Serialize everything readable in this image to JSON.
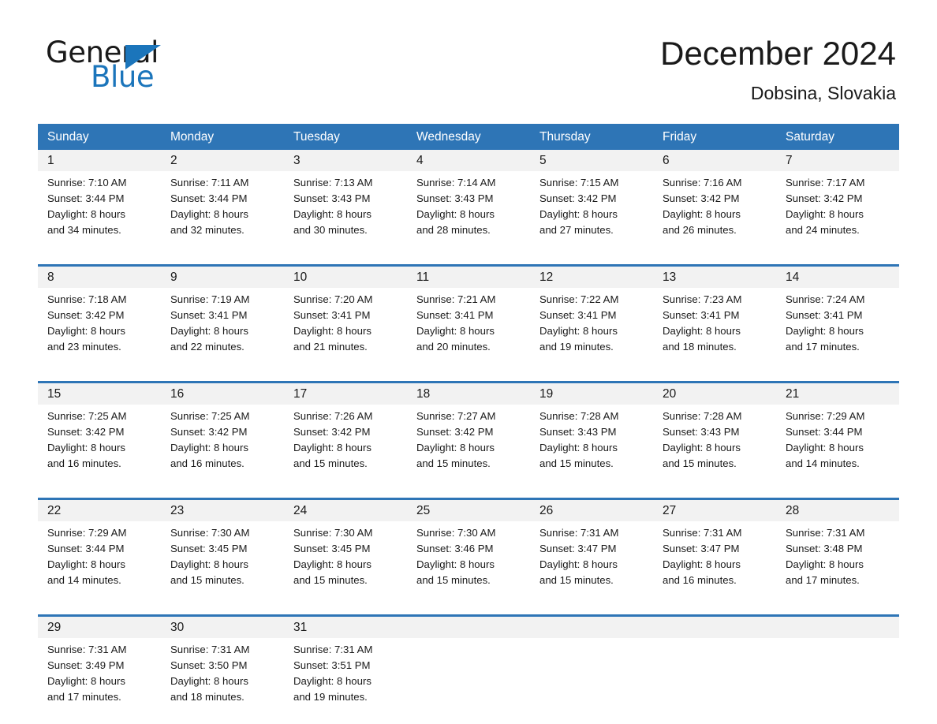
{
  "brand": {
    "word_one": "General",
    "word_two": "Blue",
    "triangle_color": "#1b75bb"
  },
  "header": {
    "title": "December 2024",
    "subtitle": "Dobsina, Slovakia"
  },
  "theme": {
    "header_blue": "#2e75b6",
    "daynum_band": "#f2f2f2",
    "text": "#1a1a1a"
  },
  "weekdays": [
    "Sunday",
    "Monday",
    "Tuesday",
    "Wednesday",
    "Thursday",
    "Friday",
    "Saturday"
  ],
  "weeks": [
    [
      {
        "day": "1",
        "sunrise": "Sunrise: 7:10 AM",
        "sunset": "Sunset: 3:44 PM",
        "daylight_1": "Daylight: 8 hours",
        "daylight_2": "and 34 minutes."
      },
      {
        "day": "2",
        "sunrise": "Sunrise: 7:11 AM",
        "sunset": "Sunset: 3:44 PM",
        "daylight_1": "Daylight: 8 hours",
        "daylight_2": "and 32 minutes."
      },
      {
        "day": "3",
        "sunrise": "Sunrise: 7:13 AM",
        "sunset": "Sunset: 3:43 PM",
        "daylight_1": "Daylight: 8 hours",
        "daylight_2": "and 30 minutes."
      },
      {
        "day": "4",
        "sunrise": "Sunrise: 7:14 AM",
        "sunset": "Sunset: 3:43 PM",
        "daylight_1": "Daylight: 8 hours",
        "daylight_2": "and 28 minutes."
      },
      {
        "day": "5",
        "sunrise": "Sunrise: 7:15 AM",
        "sunset": "Sunset: 3:42 PM",
        "daylight_1": "Daylight: 8 hours",
        "daylight_2": "and 27 minutes."
      },
      {
        "day": "6",
        "sunrise": "Sunrise: 7:16 AM",
        "sunset": "Sunset: 3:42 PM",
        "daylight_1": "Daylight: 8 hours",
        "daylight_2": "and 26 minutes."
      },
      {
        "day": "7",
        "sunrise": "Sunrise: 7:17 AM",
        "sunset": "Sunset: 3:42 PM",
        "daylight_1": "Daylight: 8 hours",
        "daylight_2": "and 24 minutes."
      }
    ],
    [
      {
        "day": "8",
        "sunrise": "Sunrise: 7:18 AM",
        "sunset": "Sunset: 3:42 PM",
        "daylight_1": "Daylight: 8 hours",
        "daylight_2": "and 23 minutes."
      },
      {
        "day": "9",
        "sunrise": "Sunrise: 7:19 AM",
        "sunset": "Sunset: 3:41 PM",
        "daylight_1": "Daylight: 8 hours",
        "daylight_2": "and 22 minutes."
      },
      {
        "day": "10",
        "sunrise": "Sunrise: 7:20 AM",
        "sunset": "Sunset: 3:41 PM",
        "daylight_1": "Daylight: 8 hours",
        "daylight_2": "and 21 minutes."
      },
      {
        "day": "11",
        "sunrise": "Sunrise: 7:21 AM",
        "sunset": "Sunset: 3:41 PM",
        "daylight_1": "Daylight: 8 hours",
        "daylight_2": "and 20 minutes."
      },
      {
        "day": "12",
        "sunrise": "Sunrise: 7:22 AM",
        "sunset": "Sunset: 3:41 PM",
        "daylight_1": "Daylight: 8 hours",
        "daylight_2": "and 19 minutes."
      },
      {
        "day": "13",
        "sunrise": "Sunrise: 7:23 AM",
        "sunset": "Sunset: 3:41 PM",
        "daylight_1": "Daylight: 8 hours",
        "daylight_2": "and 18 minutes."
      },
      {
        "day": "14",
        "sunrise": "Sunrise: 7:24 AM",
        "sunset": "Sunset: 3:41 PM",
        "daylight_1": "Daylight: 8 hours",
        "daylight_2": "and 17 minutes."
      }
    ],
    [
      {
        "day": "15",
        "sunrise": "Sunrise: 7:25 AM",
        "sunset": "Sunset: 3:42 PM",
        "daylight_1": "Daylight: 8 hours",
        "daylight_2": "and 16 minutes."
      },
      {
        "day": "16",
        "sunrise": "Sunrise: 7:25 AM",
        "sunset": "Sunset: 3:42 PM",
        "daylight_1": "Daylight: 8 hours",
        "daylight_2": "and 16 minutes."
      },
      {
        "day": "17",
        "sunrise": "Sunrise: 7:26 AM",
        "sunset": "Sunset: 3:42 PM",
        "daylight_1": "Daylight: 8 hours",
        "daylight_2": "and 15 minutes."
      },
      {
        "day": "18",
        "sunrise": "Sunrise: 7:27 AM",
        "sunset": "Sunset: 3:42 PM",
        "daylight_1": "Daylight: 8 hours",
        "daylight_2": "and 15 minutes."
      },
      {
        "day": "19",
        "sunrise": "Sunrise: 7:28 AM",
        "sunset": "Sunset: 3:43 PM",
        "daylight_1": "Daylight: 8 hours",
        "daylight_2": "and 15 minutes."
      },
      {
        "day": "20",
        "sunrise": "Sunrise: 7:28 AM",
        "sunset": "Sunset: 3:43 PM",
        "daylight_1": "Daylight: 8 hours",
        "daylight_2": "and 15 minutes."
      },
      {
        "day": "21",
        "sunrise": "Sunrise: 7:29 AM",
        "sunset": "Sunset: 3:44 PM",
        "daylight_1": "Daylight: 8 hours",
        "daylight_2": "and 14 minutes."
      }
    ],
    [
      {
        "day": "22",
        "sunrise": "Sunrise: 7:29 AM",
        "sunset": "Sunset: 3:44 PM",
        "daylight_1": "Daylight: 8 hours",
        "daylight_2": "and 14 minutes."
      },
      {
        "day": "23",
        "sunrise": "Sunrise: 7:30 AM",
        "sunset": "Sunset: 3:45 PM",
        "daylight_1": "Daylight: 8 hours",
        "daylight_2": "and 15 minutes."
      },
      {
        "day": "24",
        "sunrise": "Sunrise: 7:30 AM",
        "sunset": "Sunset: 3:45 PM",
        "daylight_1": "Daylight: 8 hours",
        "daylight_2": "and 15 minutes."
      },
      {
        "day": "25",
        "sunrise": "Sunrise: 7:30 AM",
        "sunset": "Sunset: 3:46 PM",
        "daylight_1": "Daylight: 8 hours",
        "daylight_2": "and 15 minutes."
      },
      {
        "day": "26",
        "sunrise": "Sunrise: 7:31 AM",
        "sunset": "Sunset: 3:47 PM",
        "daylight_1": "Daylight: 8 hours",
        "daylight_2": "and 15 minutes."
      },
      {
        "day": "27",
        "sunrise": "Sunrise: 7:31 AM",
        "sunset": "Sunset: 3:47 PM",
        "daylight_1": "Daylight: 8 hours",
        "daylight_2": "and 16 minutes."
      },
      {
        "day": "28",
        "sunrise": "Sunrise: 7:31 AM",
        "sunset": "Sunset: 3:48 PM",
        "daylight_1": "Daylight: 8 hours",
        "daylight_2": "and 17 minutes."
      }
    ],
    [
      {
        "day": "29",
        "sunrise": "Sunrise: 7:31 AM",
        "sunset": "Sunset: 3:49 PM",
        "daylight_1": "Daylight: 8 hours",
        "daylight_2": "and 17 minutes."
      },
      {
        "day": "30",
        "sunrise": "Sunrise: 7:31 AM",
        "sunset": "Sunset: 3:50 PM",
        "daylight_1": "Daylight: 8 hours",
        "daylight_2": "and 18 minutes."
      },
      {
        "day": "31",
        "sunrise": "Sunrise: 7:31 AM",
        "sunset": "Sunset: 3:51 PM",
        "daylight_1": "Daylight: 8 hours",
        "daylight_2": "and 19 minutes."
      },
      {
        "day": "",
        "sunrise": "",
        "sunset": "",
        "daylight_1": "",
        "daylight_2": ""
      },
      {
        "day": "",
        "sunrise": "",
        "sunset": "",
        "daylight_1": "",
        "daylight_2": ""
      },
      {
        "day": "",
        "sunrise": "",
        "sunset": "",
        "daylight_1": "",
        "daylight_2": ""
      },
      {
        "day": "",
        "sunrise": "",
        "sunset": "",
        "daylight_1": "",
        "daylight_2": ""
      }
    ]
  ]
}
